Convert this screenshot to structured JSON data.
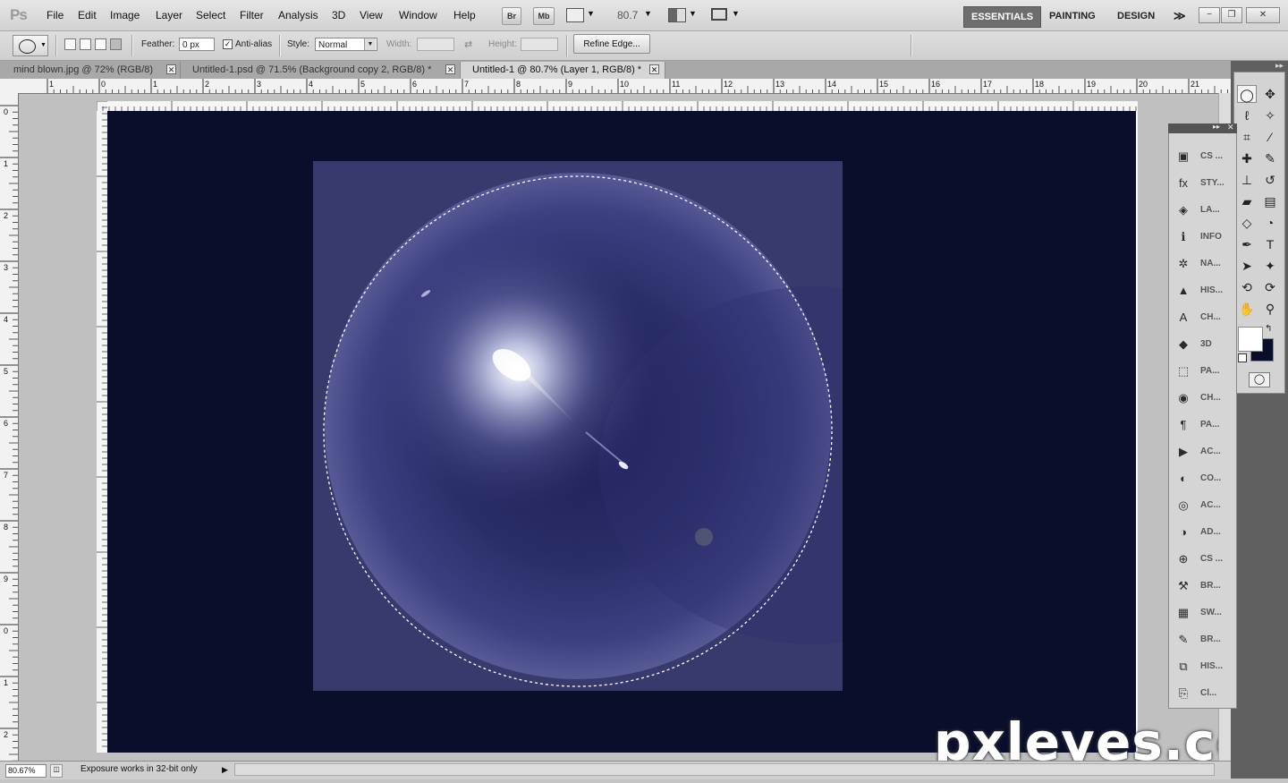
{
  "app": {
    "logo": "Ps"
  },
  "menu": [
    "File",
    "Edit",
    "Image",
    "Layer",
    "Select",
    "Filter",
    "Analysis",
    "3D",
    "View",
    "Window",
    "Help"
  ],
  "launch_buttons": {
    "bridge": "Br",
    "mini_bridge": "Mb"
  },
  "zoom_menu_value": "80.7",
  "workspaces": {
    "active": "ESSENTIALS",
    "painting": "PAINTING",
    "design": "DESIGN",
    "more": "≫"
  },
  "window_controls": {
    "minimize": "−",
    "restore": "❐",
    "close": "✕"
  },
  "options": {
    "feather_label": "Feather:",
    "feather_value": "0 px",
    "antialias_label": "Anti-alias",
    "antialias_checked": true,
    "style_label": "Style:",
    "style_value": "Normal",
    "width_label": "Width:",
    "height_label": "Height:",
    "refine_edge": "Refine Edge..."
  },
  "tabs": [
    {
      "title": "mind blown.jpg @ 72% (RGB/8)",
      "active": false
    },
    {
      "title": "Untitled-1.psd @ 71.5% (Background copy 2, RGB/8) *",
      "active": false
    },
    {
      "title": "Untitled-1 @ 80.7% (Layer 1, RGB/8) *",
      "active": true
    }
  ],
  "ruler_top_labels": [
    "1",
    "0",
    "1",
    "2",
    "3",
    "4",
    "5",
    "6",
    "7",
    "8",
    "9",
    "10",
    "11",
    "12",
    "13",
    "14",
    "15",
    "16",
    "17",
    "18",
    "19",
    "20",
    "21"
  ],
  "ruler_left_labels": [
    "0",
    "1",
    "2",
    "3",
    "4",
    "5",
    "6",
    "7",
    "8",
    "9",
    "0",
    "1",
    "2"
  ],
  "status": {
    "zoom": "80.67%",
    "message": "Exposure works in 32-bit only"
  },
  "panels": [
    {
      "icon": "cs-review-icon",
      "glyph": "▣",
      "label": "CS ..."
    },
    {
      "icon": "styles-icon",
      "glyph": "fx",
      "label": "STY..."
    },
    {
      "icon": "layers-icon",
      "glyph": "◈",
      "label": "LA..."
    },
    {
      "icon": "info-icon",
      "glyph": "ℹ",
      "label": "INFO"
    },
    {
      "icon": "navigator-icon",
      "glyph": "✲",
      "label": "NA..."
    },
    {
      "icon": "histogram-icon",
      "glyph": "▲",
      "label": "HIS..."
    },
    {
      "icon": "character-icon",
      "glyph": "A",
      "label": "CH..."
    },
    {
      "icon": "3d-icon",
      "glyph": "◆",
      "label": "3D"
    },
    {
      "icon": "paths-icon",
      "glyph": "⬚",
      "label": "PA..."
    },
    {
      "icon": "channels-icon",
      "glyph": "◉",
      "label": "CH..."
    },
    {
      "icon": "paragraph-icon",
      "glyph": "¶",
      "label": "PA..."
    },
    {
      "icon": "actions-icon",
      "glyph": "▶",
      "label": "AC..."
    },
    {
      "icon": "color-icon",
      "glyph": "◐",
      "label": "CO..."
    },
    {
      "icon": "animation-icon",
      "glyph": "◎",
      "label": "AC..."
    },
    {
      "icon": "adjustments-icon",
      "glyph": "◑",
      "label": "AD..."
    },
    {
      "icon": "cs-live-icon",
      "glyph": "⊕",
      "label": "CS ..."
    },
    {
      "icon": "brush-presets-icon",
      "glyph": "⚒",
      "label": "BR..."
    },
    {
      "icon": "swatches-icon",
      "glyph": "▦",
      "label": "SW..."
    },
    {
      "icon": "brushes-icon",
      "glyph": "✎",
      "label": "BR..."
    },
    {
      "icon": "history-icon",
      "glyph": "⧉",
      "label": "HIS..."
    },
    {
      "icon": "clone-source-icon",
      "glyph": "⎘",
      "label": "Cl..."
    }
  ],
  "tools": [
    {
      "name": "elliptical-marquee-icon",
      "glyph": "◯"
    },
    {
      "name": "move-tool-icon",
      "glyph": "✥"
    },
    {
      "name": "lasso-icon",
      "glyph": "ℓ"
    },
    {
      "name": "magic-wand-icon",
      "glyph": "✧"
    },
    {
      "name": "crop-icon",
      "glyph": "⌗"
    },
    {
      "name": "eyedropper-icon",
      "glyph": "⁄"
    },
    {
      "name": "healing-brush-icon",
      "glyph": "✚"
    },
    {
      "name": "brush-icon",
      "glyph": "✎"
    },
    {
      "name": "clone-stamp-icon",
      "glyph": "⊥"
    },
    {
      "name": "history-brush-icon",
      "glyph": "↺"
    },
    {
      "name": "eraser-icon",
      "glyph": "▰"
    },
    {
      "name": "gradient-icon",
      "glyph": "▤"
    },
    {
      "name": "blur-icon",
      "glyph": "◇"
    },
    {
      "name": "dodge-icon",
      "glyph": "◔"
    },
    {
      "name": "pen-icon",
      "glyph": "✒"
    },
    {
      "name": "type-icon",
      "glyph": "T"
    },
    {
      "name": "path-selection-icon",
      "glyph": "➤"
    },
    {
      "name": "custom-shape-icon",
      "glyph": "✦"
    },
    {
      "name": "3d-rotate-icon",
      "glyph": "⟲"
    },
    {
      "name": "3d-orbit-icon",
      "glyph": "⟳"
    },
    {
      "name": "hand-icon",
      "glyph": "✋"
    },
    {
      "name": "zoom-icon",
      "glyph": "⚲"
    }
  ],
  "colors": {
    "foreground": "#ffffff",
    "background": "#0b0e2b",
    "canvas": "#0b0e2b",
    "layer": "#373a6c"
  },
  "watermark": "pxleyes.com"
}
